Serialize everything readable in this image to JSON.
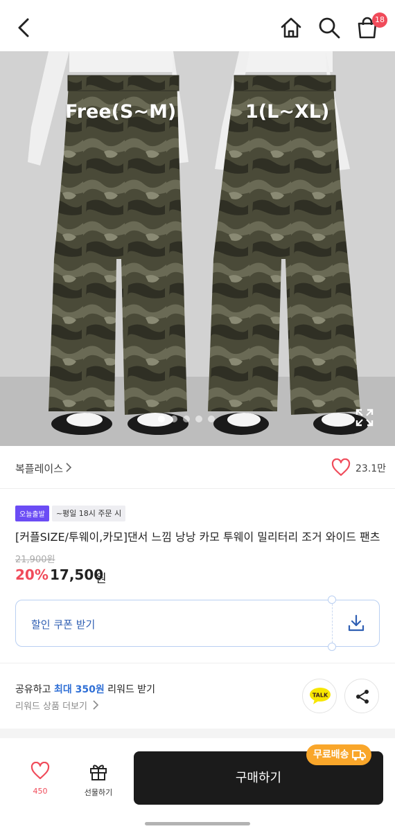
{
  "header": {
    "back_icon": "chevron-left-icon",
    "home_icon": "home-icon",
    "search_icon": "search-icon",
    "cart_icon": "shopping-bag-icon",
    "cart_count": "18"
  },
  "hero": {
    "size_label_left": "Free(S~M)",
    "size_label_right": "1(L~XL)",
    "dots_total": 5,
    "dots_active": 1,
    "expand_icon": "expand-icon"
  },
  "brand": {
    "name": "복플레이스",
    "like_count": "23.1만"
  },
  "product": {
    "tag_delivery": "오늘출발",
    "tag_condition": "~평일 18시 주문 시",
    "title": "[커플SIZE/투웨이,카모]댄서 느낌 낭낭 카모 투웨이 밀리터리 조거 와이드 팬츠",
    "original_price": "21,900원",
    "discount": "20%",
    "sale_price": "17,500",
    "currency": "원"
  },
  "coupon": {
    "label": "할인 쿠폰 받기"
  },
  "reward": {
    "prefix": "공유하고 ",
    "highlight": "최대 350원",
    "suffix": " 리워드 받기",
    "link": "리워드 상품 더보기",
    "talk_label": "TALK"
  },
  "bottom": {
    "wish_count": "450",
    "gift_label": "선물하기",
    "buy_label": "구매하기",
    "free_shipping": "무료배송"
  },
  "colors": {
    "accent_red": "#f04b5a",
    "buy_button": "#1b1b1b",
    "free_ship_badge": "#f9a62a",
    "coupon_border": "#b9cff2",
    "tag_purple": "#6b4cf5"
  }
}
